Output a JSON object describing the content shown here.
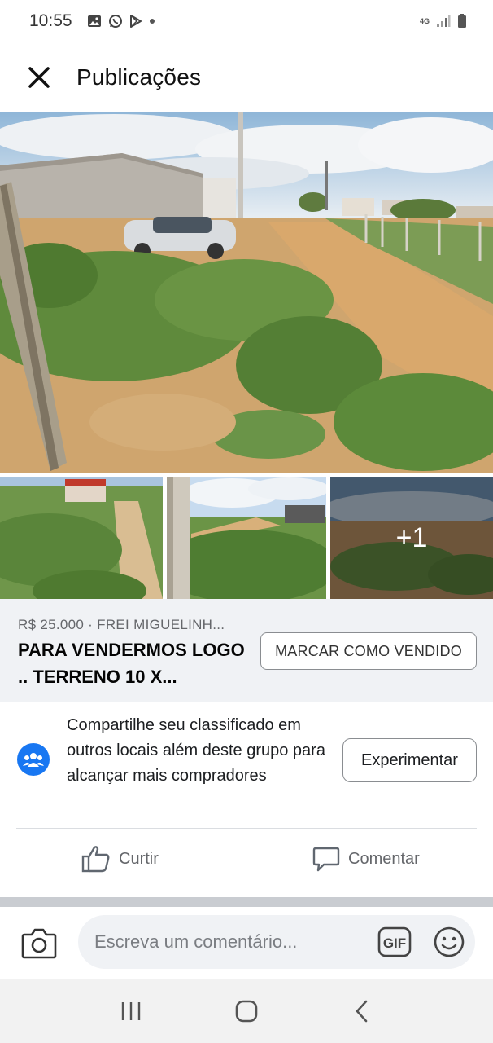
{
  "status_bar": {
    "time": "10:55",
    "left_icons": [
      "gallery-icon",
      "whatsapp-icon",
      "play-store-icon",
      "dot-icon"
    ],
    "network": "4G",
    "right_icons": [
      "signal-icon",
      "battery-icon"
    ]
  },
  "header": {
    "title": "Publicações",
    "close_icon": "close-icon"
  },
  "gallery": {
    "main_photo": "rural-land-photo",
    "thumbnails": [
      "thumb-1",
      "thumb-2",
      "thumb-3"
    ],
    "more_count": "+1"
  },
  "listing": {
    "meta": "R$ 25.000 · FREI MIGUELINH...",
    "title": "PARA VENDERMOS LOGO .. TERRENO 10 X...",
    "mark_sold_label": "MARCAR COMO VENDIDO"
  },
  "share": {
    "icon": "group-icon",
    "text": "Compartilhe seu classificado em outros locais além deste grupo para alcançar mais compradores",
    "button_label": "Experimentar"
  },
  "actions": {
    "like_label": "Curtir",
    "like_icon": "thumbs-up-icon",
    "comment_label": "Comentar",
    "comment_icon": "comment-bubble-icon"
  },
  "composer": {
    "placeholder": "Escreva um comentário...",
    "camera_icon": "camera-icon",
    "gif_label": "GIF",
    "emoji_icon": "smiley-icon"
  },
  "navbar": {
    "icons": [
      "recent-apps-icon",
      "home-icon",
      "back-icon"
    ]
  },
  "colors": {
    "accent": "#1877f2",
    "listing_bg": "#f0f2f5",
    "secondary_text": "#65676b",
    "dirt_road": "#d9a86c"
  }
}
